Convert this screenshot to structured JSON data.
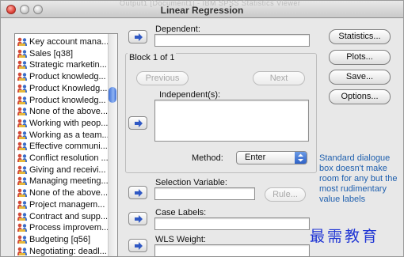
{
  "window": {
    "title": "Linear Regression",
    "ghost_title": "Output1 [Document1] - IBM SPSS Statistics Viewer"
  },
  "variables": [
    "Key account mana...",
    "Sales [q38]",
    "Strategic marketin...",
    "Product knowledg...",
    "Product Knowledg...",
    "Product knowledg...",
    "None of the above...",
    "Working with peop...",
    "Working as a team...",
    "Effective communi...",
    "Conflict resolution ...",
    "Giving and receivi...",
    "Managing meeting...",
    "None of the above...",
    "Project managem...",
    "Contract and supp...",
    "Process improvem...",
    "Budgeting [q56]",
    "Negotiating: deadl..."
  ],
  "labels": {
    "dependent": "Dependent:",
    "block": "Block 1 of 1",
    "independent": "Independent(s):",
    "method": "Method:",
    "selection": "Selection Variable:",
    "case_labels": "Case Labels:",
    "wls": "WLS Weight:"
  },
  "buttons": {
    "previous": "Previous",
    "next": "Next",
    "rule": "Rule...",
    "statistics": "Statistics...",
    "plots": "Plots...",
    "save": "Save...",
    "options": "Options..."
  },
  "method_value": "Enter",
  "annotation": "Standard dialogue box doesn't make room for any but the most rudimentary value labels",
  "watermark": "最需教育",
  "colors": {
    "accent": "#2f62c7",
    "annotation": "#1e5fae",
    "watermark": "#1f35d4"
  }
}
